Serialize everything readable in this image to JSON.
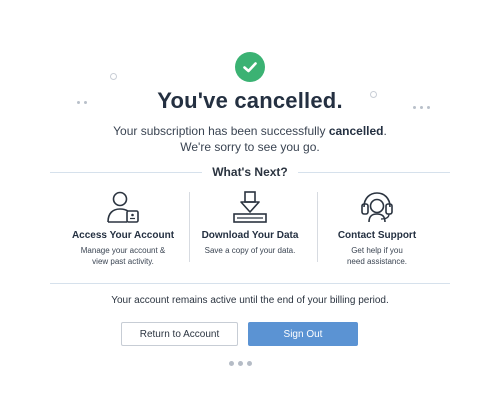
{
  "header": {
    "title": "You've cancelled.",
    "subtitle_prefix": "Your subscription has been successfully ",
    "subtitle_bold": "cancelled",
    "subtitle_suffix": ".",
    "subtitle_line2": "We're sorry to see you go."
  },
  "next_section": {
    "heading": "What's Next?",
    "items": [
      {
        "icon": "user-card-icon",
        "title": "Access Your Account",
        "desc_line1": "Manage your account &",
        "desc_line2": "view past activity."
      },
      {
        "icon": "download-tray-icon",
        "title": "Download Your Data",
        "desc_line1": "Save a copy of your data.",
        "desc_line2": ""
      },
      {
        "icon": "headset-support-icon",
        "title": "Contact Support",
        "desc_line1": "Get help if you",
        "desc_line2": "need assistance."
      }
    ]
  },
  "footer": {
    "note": "Your account remains active until the end of your billing period.",
    "return_label": "Return to Account",
    "signout_label": "Sign Out"
  },
  "colors": {
    "success": "#3bb273",
    "primary": "#5b93d3",
    "text": "#243041"
  }
}
